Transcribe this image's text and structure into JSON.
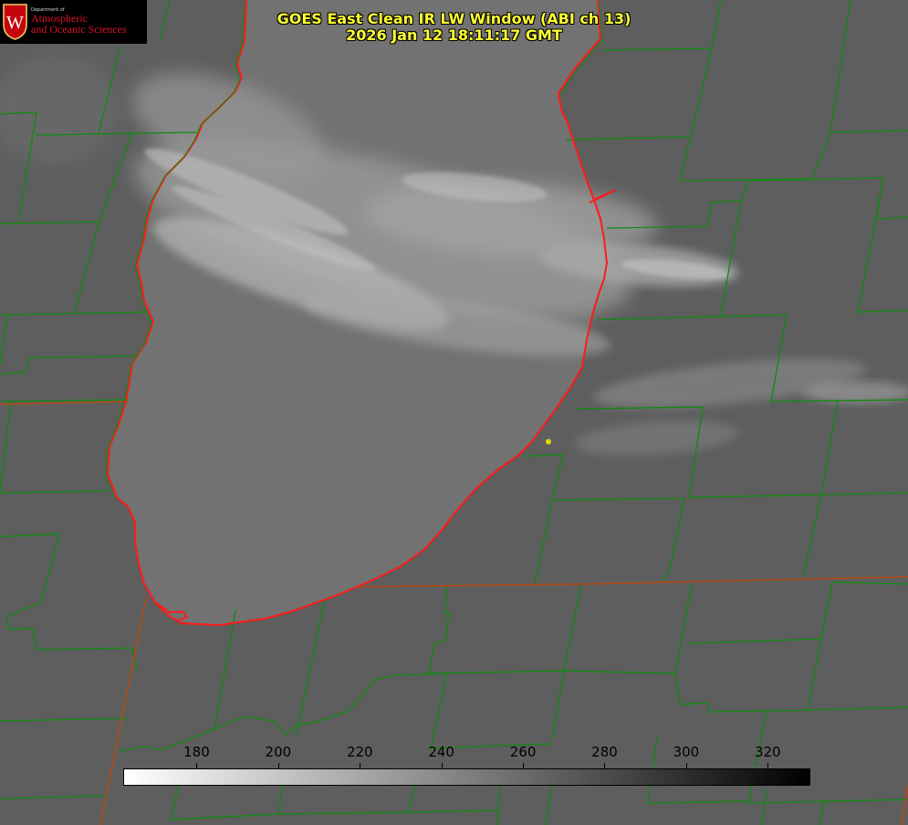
{
  "logo": {
    "dept": "Department of",
    "line1": "Atmospheric",
    "line2": "and Oceanic Sciences",
    "seal_letter": "W",
    "seal_color": "#c5050c"
  },
  "title": {
    "line1": "GOES East Clean IR LW Window (ABI ch 13)",
    "line2": "2026 Jan 12 18:11:17 GMT"
  },
  "colorbar": {
    "min": 162,
    "max": 330,
    "ticks": [
      "180",
      "200",
      "220",
      "240",
      "260",
      "280",
      "300",
      "320"
    ],
    "gradient": [
      "#ffffff",
      "#000000"
    ]
  },
  "colors": {
    "background": "#5e5e5e",
    "lake": "#727272",
    "cloud": "#b8b8b8",
    "county_lines": "#0e8c0e",
    "state_lines": "#b24a14",
    "coastline": "#ff1a1a",
    "title": "#ffff33",
    "marker": "#e6d600"
  }
}
